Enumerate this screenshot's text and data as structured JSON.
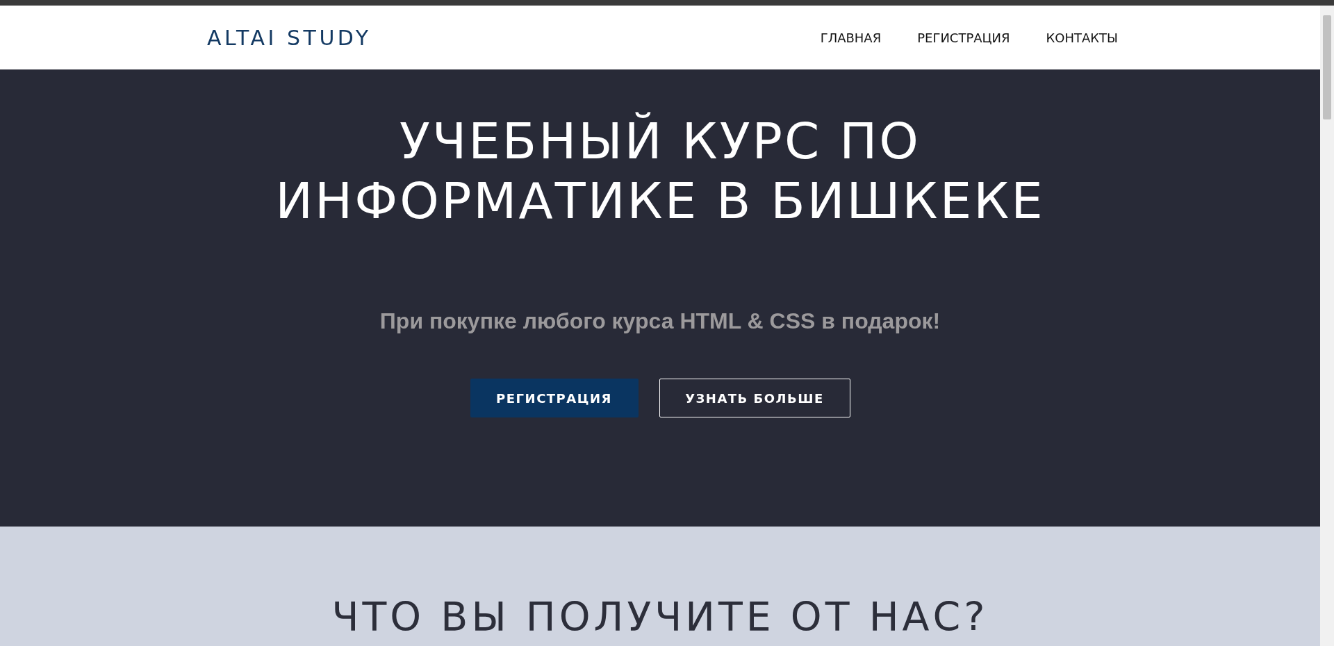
{
  "header": {
    "logo": "ALTAI STUDY",
    "nav": [
      {
        "label": "ГЛАВНАЯ"
      },
      {
        "label": "РЕГИСТРАЦИЯ"
      },
      {
        "label": "КОНТАКТЫ"
      }
    ]
  },
  "hero": {
    "title_lines": [
      "УЧЕБНЫЙ КУРС ПО",
      "ИНФОРМАТИКЕ В БИШКЕКЕ"
    ],
    "subtitle": "При покупке любого курса HTML & CSS в подарок!",
    "buttons": [
      {
        "label": "РЕГИСТРАЦИЯ",
        "kind": "filled"
      },
      {
        "label": "УЗНАТЬ БОЛЬШЕ",
        "kind": "outline"
      }
    ]
  },
  "features": {
    "heading": "ЧТО ВЫ ПОЛУЧИТЕ ОТ НАС?"
  }
}
